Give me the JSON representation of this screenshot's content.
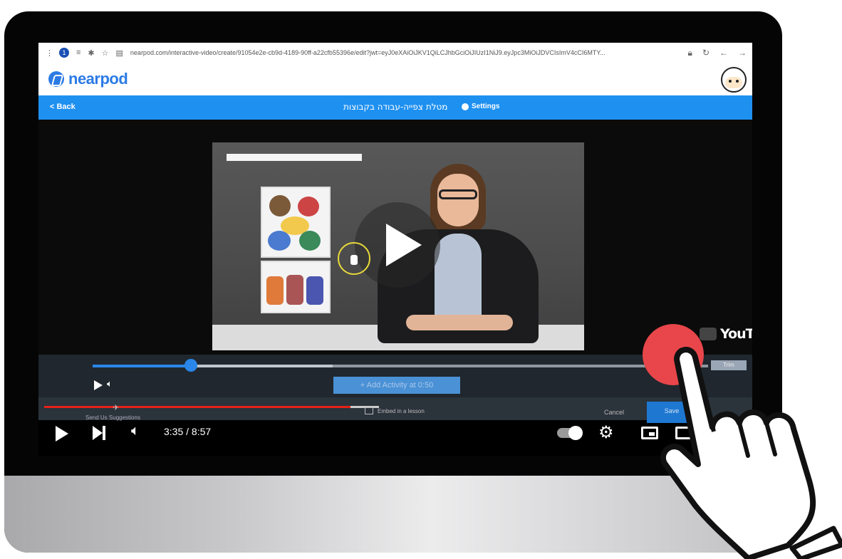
{
  "browser": {
    "url": "nearpod.com/interactive-video/create/91054e2e-cb9d-4189-90ff-a22cfb55396e/edit?jwt=eyJ0eXAiOiJKV1QiLCJhbGciOiJIUzI1NiJ9.eyJpc3MiOiJDVCIsImV4cCI6MTY...",
    "profile_badge": "1"
  },
  "nearpod": {
    "logo_text": "nearpod"
  },
  "toolbar": {
    "back_label": "< Back",
    "lesson_title": "מטלת צפייה-עבודה בקבוצות",
    "settings_label": "Settings"
  },
  "video": {
    "youtube_label": "YouTube"
  },
  "editor": {
    "progress": 0.16,
    "buffer": 0.39,
    "trim_label": "Trim",
    "add_activity_label": "+ Add Activity at 0:50"
  },
  "lowerbar": {
    "suggestions_label": "Send Us Suggestions",
    "embed_label": "Embed in a lesson",
    "cancel_label": "Cancel",
    "save_label": "Save"
  },
  "player": {
    "current_time": "3:35",
    "duration": "8:57",
    "time_display": "3:35 / 8:57",
    "progress": 0.4
  },
  "colors": {
    "nearpod_blue": "#1e90f0",
    "timeline_blue": "#2a86e8",
    "youtube_red": "#e62117",
    "tap_indicator": "#e8464a"
  }
}
